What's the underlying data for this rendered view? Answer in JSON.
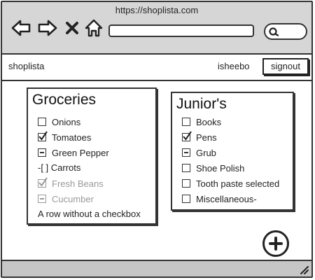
{
  "browser": {
    "url": "https://shoplista.com",
    "icons": {
      "back": "arrow-left-icon",
      "forward": "arrow-right-icon",
      "stop": "close-icon",
      "home": "home-icon",
      "search": "search-icon"
    }
  },
  "appbar": {
    "brand": "shoplista",
    "username": "isheebo",
    "signout_label": "signout"
  },
  "lists": [
    {
      "title": "Groceries",
      "items": [
        {
          "label": "Onions",
          "state": "unchecked"
        },
        {
          "label": "Tomatoes",
          "state": "checked"
        },
        {
          "label": "Green Pepper",
          "state": "indeterminate"
        },
        {
          "label": "-[ ] Carrots",
          "state": "none"
        },
        {
          "label": "Fresh Beans",
          "state": "checked-disabled"
        },
        {
          "label": "Cucumber",
          "state": "indeterminate-disabled"
        },
        {
          "label": "A row without a checkbox",
          "state": "none"
        }
      ]
    },
    {
      "title": "Junior's",
      "items": [
        {
          "label": "Books",
          "state": "unchecked"
        },
        {
          "label": "Pens",
          "state": "checked"
        },
        {
          "label": "Grub",
          "state": "indeterminate"
        },
        {
          "label": "Shoe Polish",
          "state": "unchecked"
        },
        {
          "label": "Tooth paste selected",
          "state": "unchecked"
        },
        {
          "label": "Miscellaneous-",
          "state": "unchecked"
        }
      ]
    }
  ],
  "fab": {
    "icon": "plus-icon"
  },
  "colors": {
    "chrome": "#d6d6d6",
    "statusbar": "#c6c6c6",
    "disabled_text": "#999999",
    "ink": "#222222"
  }
}
